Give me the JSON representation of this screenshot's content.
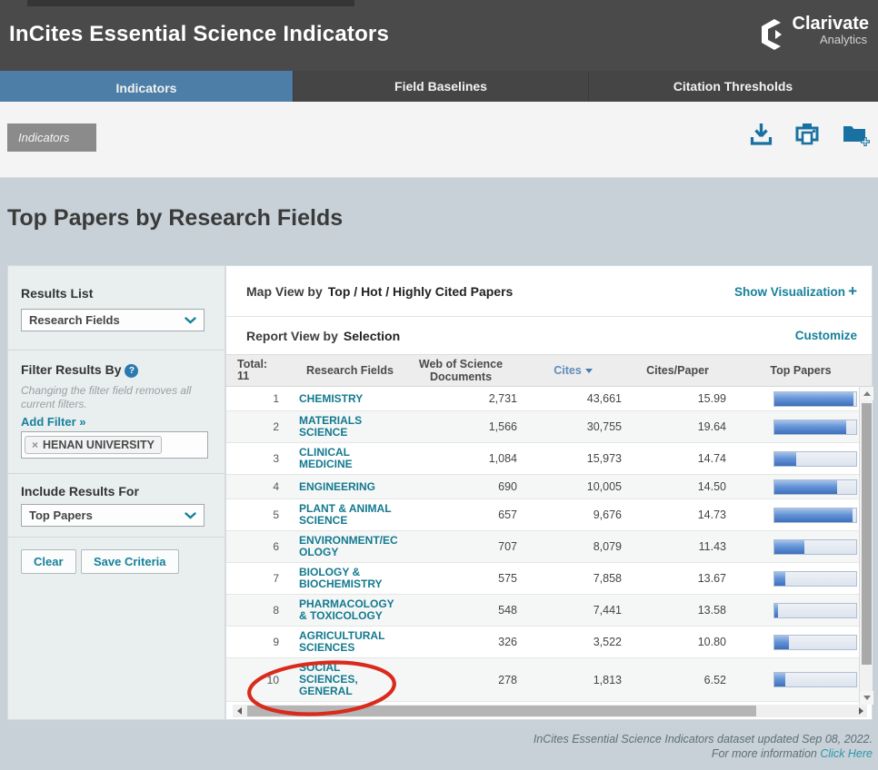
{
  "header": {
    "title": "InCites Essential Science Indicators",
    "logo_brand": "Clarivate",
    "logo_sub": "Analytics"
  },
  "tabs": [
    {
      "label": "Indicators"
    },
    {
      "label": "Field Baselines"
    },
    {
      "label": "Citation Thresholds"
    }
  ],
  "breadcrumb": {
    "label": "Indicators"
  },
  "toolbar_icons": [
    "download-icon",
    "print-icon",
    "folder-add-icon"
  ],
  "page_title": "Top Papers by Research Fields",
  "sidebar": {
    "results_list": {
      "heading": "Results List",
      "selected": "Research Fields"
    },
    "filter": {
      "heading": "Filter Results By",
      "help": "?",
      "note": "Changing the filter field removes all current filters.",
      "add_filter": "Add Filter »",
      "tag": {
        "remove": "×",
        "label": "HENAN UNIVERSITY"
      }
    },
    "include_results": {
      "heading": "Include Results For",
      "selected": "Top Papers"
    },
    "buttons": {
      "clear": "Clear",
      "save": "Save Criteria"
    }
  },
  "main": {
    "map_view": {
      "label": "Map View by",
      "value": "Top / Hot / Highly Cited Papers",
      "action": "Show Visualization",
      "plus": "+"
    },
    "report_view": {
      "label": "Report View by",
      "value": "Selection",
      "action": "Customize"
    }
  },
  "table": {
    "total_label": "Total:",
    "total_value": "11",
    "columns": {
      "field": "Research Fields",
      "wos": "Web of Science Documents",
      "cites": "Cites",
      "cpp": "Cites/Paper",
      "top": "Top Papers"
    },
    "sorted_by": "Cites",
    "rows": [
      {
        "rank": "1",
        "field": "CHEMISTRY",
        "wos_documents": "2,731",
        "cites": "43,661",
        "cites_per_paper": "15.99",
        "top_papers_bar_pct": 97
      },
      {
        "rank": "2",
        "field": "MATERIALS SCIENCE",
        "wos_documents": "1,566",
        "cites": "30,755",
        "cites_per_paper": "19.64",
        "top_papers_bar_pct": 88
      },
      {
        "rank": "3",
        "field": "CLINICAL MEDICINE",
        "wos_documents": "1,084",
        "cites": "15,973",
        "cites_per_paper": "14.74",
        "top_papers_bar_pct": 27
      },
      {
        "rank": "4",
        "field": "ENGINEERING",
        "wos_documents": "690",
        "cites": "10,005",
        "cites_per_paper": "14.50",
        "top_papers_bar_pct": 77
      },
      {
        "rank": "5",
        "field": "PLANT & ANIMAL SCIENCE",
        "wos_documents": "657",
        "cites": "9,676",
        "cites_per_paper": "14.73",
        "top_papers_bar_pct": 96
      },
      {
        "rank": "6",
        "field": "ENVIRONMENT/ECOLOGY",
        "wos_documents": "707",
        "cites": "8,079",
        "cites_per_paper": "11.43",
        "top_papers_bar_pct": 37
      },
      {
        "rank": "7",
        "field": "BIOLOGY & BIOCHEMISTRY",
        "wos_documents": "575",
        "cites": "7,858",
        "cites_per_paper": "13.67",
        "top_papers_bar_pct": 13
      },
      {
        "rank": "8",
        "field": "PHARMACOLOGY & TOXICOLOGY",
        "wos_documents": "548",
        "cites": "7,441",
        "cites_per_paper": "13.58",
        "top_papers_bar_pct": 4
      },
      {
        "rank": "9",
        "field": "AGRICULTURAL SCIENCES",
        "wos_documents": "326",
        "cites": "3,522",
        "cites_per_paper": "10.80",
        "top_papers_bar_pct": 18
      },
      {
        "rank": "10",
        "field": "SOCIAL SCIENCES, GENERAL",
        "wos_documents": "278",
        "cites": "1,813",
        "cites_per_paper": "6.52",
        "top_papers_bar_pct": 13,
        "circled": true
      }
    ]
  },
  "footer": {
    "line1": "InCites Essential Science Indicators dataset updated Sep 08, 2022.",
    "line2": "For more information",
    "link": "Click Here"
  },
  "colors": {
    "header_bg": "#4a4a4a",
    "active_tab": "#4d7ea7",
    "page_bg": "#c7d1d7",
    "teal_link": "#17809b",
    "icon_blue": "#1871a1",
    "cites_sorted": "#5f8cbe",
    "field_link": "#13798f",
    "bar_fill": "#3e6fba",
    "annotation_red": "#d92b1c"
  }
}
